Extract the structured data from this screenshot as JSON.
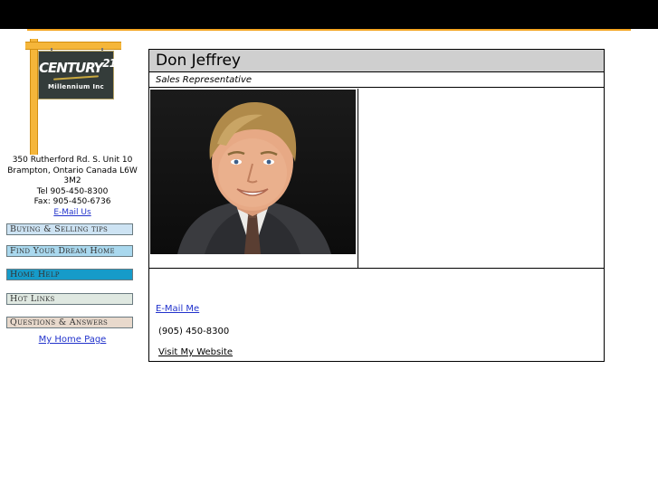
{
  "logo": {
    "brand": "CENTURY",
    "brand_number": "21",
    "subtitle": "Millennium Inc"
  },
  "office": {
    "address_line1": "350 Rutherford Rd. S. Unit 10",
    "address_line2": "Brampton, Ontario Canada L6W 3M2",
    "tel": "Tel 905-450-8300",
    "fax": "Fax: 905-450-6736",
    "email_link": "E-Mail Us"
  },
  "nav": {
    "buying_selling": "Buying & Selling tips",
    "dream_home": "Find Your Dream Home",
    "home_help": "Home Help",
    "hot_links": "Hot Links",
    "qa": "Questions & Answers",
    "home_page": "My Home Page"
  },
  "colors": {
    "nav_buying_selling": "#cde3f3",
    "nav_dream_home": "#a9d8ee",
    "nav_home_help": "#169bc9",
    "nav_hot_links": "#dfe8e1",
    "nav_qa": "#e8d9cc",
    "accent": "#f5a623"
  },
  "agent": {
    "name": "Don Jeffrey",
    "title": "Sales Representative",
    "email_link": "E-Mail Me",
    "phone": "(905) 450-8300",
    "website_link": "Visit My Website"
  }
}
